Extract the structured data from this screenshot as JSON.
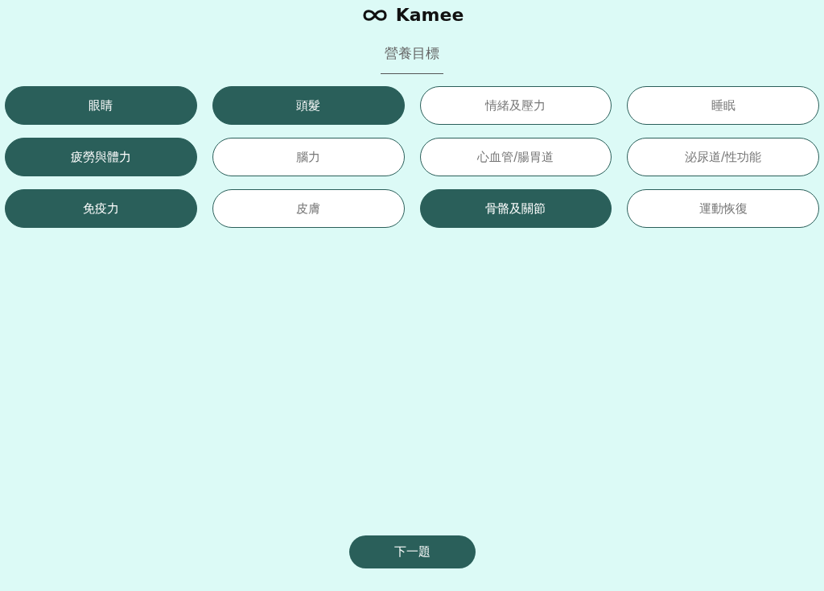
{
  "brand": "Kamee",
  "title": "營養目標",
  "options": [
    {
      "label": "眼睛",
      "selected": true
    },
    {
      "label": "頭髮",
      "selected": true
    },
    {
      "label": "情緒及壓力",
      "selected": false
    },
    {
      "label": "睡眠",
      "selected": false
    },
    {
      "label": "疲勞與體力",
      "selected": true
    },
    {
      "label": "腦力",
      "selected": false
    },
    {
      "label": "心血管/腸胃道",
      "selected": false
    },
    {
      "label": "泌尿道/性功能",
      "selected": false
    },
    {
      "label": "免疫力",
      "selected": true
    },
    {
      "label": "皮膚",
      "selected": false
    },
    {
      "label": "骨骼及關節",
      "selected": true
    },
    {
      "label": "運動恢復",
      "selected": false
    }
  ],
  "next_button": "下一題"
}
